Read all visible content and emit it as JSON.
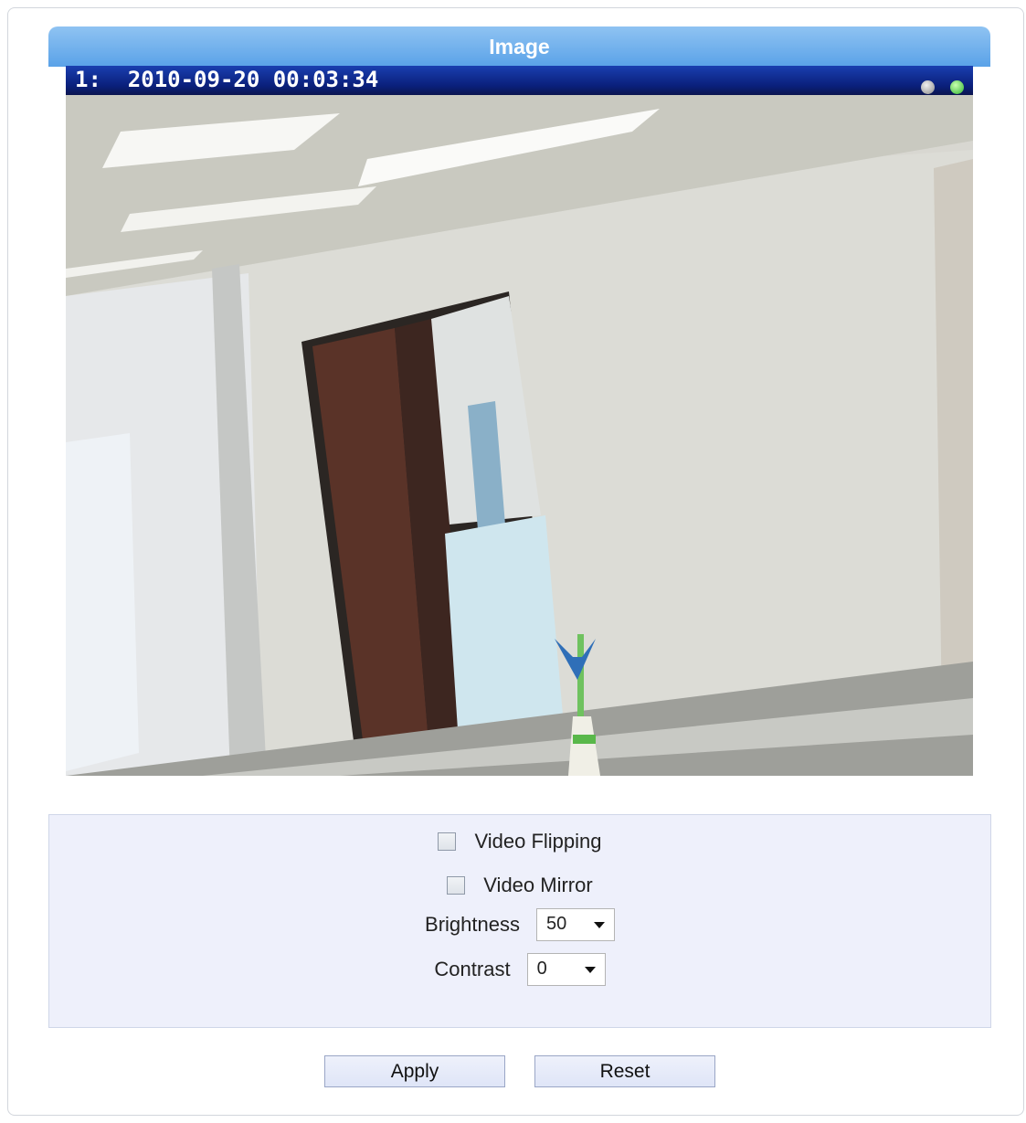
{
  "panel": {
    "title": "Image"
  },
  "video": {
    "osd_text": "1:  2010-09-20 00:03:34",
    "status_icons": [
      "status-gray-icon",
      "status-green-icon"
    ]
  },
  "settings": {
    "video_flipping": {
      "label": "Video Flipping",
      "checked": false
    },
    "video_mirror": {
      "label": "Video Mirror",
      "checked": false
    },
    "brightness": {
      "label": "Brightness",
      "value": "50"
    },
    "contrast": {
      "label": "Contrast",
      "value": "0"
    }
  },
  "buttons": {
    "apply": "Apply",
    "reset": "Reset"
  },
  "colors": {
    "title_bar": "#6aaeea",
    "osd_bar": "#0a1f7a",
    "settings_bg": "#eef0fb",
    "button_bg": "#e3e8f8"
  }
}
